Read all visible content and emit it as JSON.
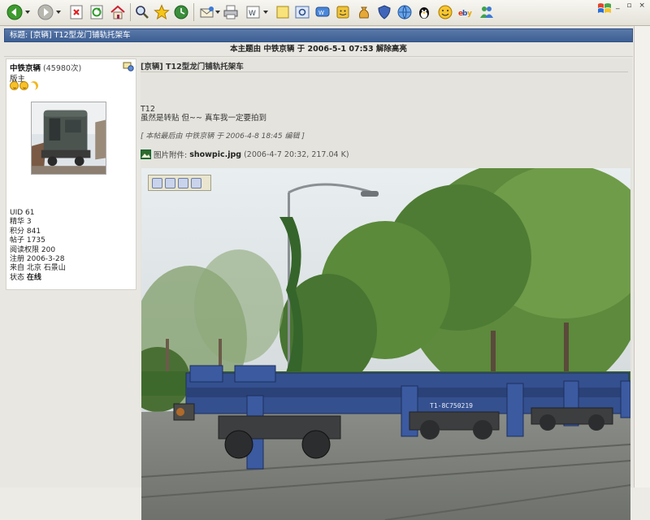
{
  "page": {
    "thread_title": "标题: [京辆] T12型龙门铺轨托架车",
    "notice": "本主题由 中铁京辆 于 2006-5-1 07:53 解除高亮"
  },
  "user": {
    "name": "中铁京辆",
    "posts_count": "(45980次)",
    "role": "版主",
    "stats": [
      {
        "label": "UID",
        "value": "61"
      },
      {
        "label": "精华",
        "value": "3"
      },
      {
        "label": "积分",
        "value": "841"
      },
      {
        "label": "帖子",
        "value": "1735"
      },
      {
        "label": "阅读权限",
        "value": "200"
      },
      {
        "label": "注册",
        "value": "2006-3-28"
      },
      {
        "label": "来自",
        "value": "北京 石景山"
      }
    ],
    "status_label": "状态",
    "status_value": "在线"
  },
  "post": {
    "title": "[京辆] T12型龙门铺轨托架车",
    "body_line1": "T12",
    "body_line2": "虽然是转贴 但~~ 真车我一定要拍到",
    "edit_note": "[ 本帖最后由 中铁京辆 于 2006-4-8 18:45 编辑 ]",
    "attachment_label": "图片附件:",
    "attachment_file": "showpic.jpg",
    "attachment_meta": "(2006-4-7 20:32, 217.04 K)",
    "car_number": "T1-8C750219"
  },
  "colors": {
    "title_bar": "#3d5f93",
    "car_blue": "#34508f"
  }
}
